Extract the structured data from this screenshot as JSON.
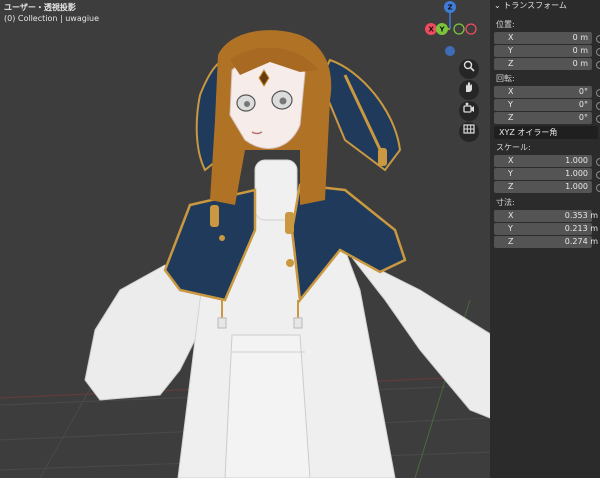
{
  "viewport": {
    "title": "ユーザー・透視投影",
    "subtitle": "(0) Collection | uwagiue",
    "gizmo": {
      "z": "Z",
      "x": "X",
      "y": "Y"
    },
    "nav_icons": [
      "zoom-icon",
      "hand-icon",
      "camera-icon",
      "grid-icon"
    ]
  },
  "panel": {
    "header": "トランスフォーム",
    "location": {
      "label": "位置:",
      "rows": [
        {
          "axis": "X",
          "value": "0 m"
        },
        {
          "axis": "Y",
          "value": "0 m"
        },
        {
          "axis": "Z",
          "value": "0 m"
        }
      ]
    },
    "rotation": {
      "label": "回転:",
      "rows": [
        {
          "axis": "X",
          "value": "0°"
        },
        {
          "axis": "Y",
          "value": "0°"
        },
        {
          "axis": "Z",
          "value": "0°"
        }
      ],
      "mode": "XYZ オイラー角"
    },
    "scale": {
      "label": "スケール:",
      "rows": [
        {
          "axis": "X",
          "value": "1.000"
        },
        {
          "axis": "Y",
          "value": "1.000"
        },
        {
          "axis": "Z",
          "value": "1.000"
        }
      ]
    },
    "dimensions": {
      "label": "寸法:",
      "rows": [
        {
          "axis": "X",
          "value": "0.353 m"
        },
        {
          "axis": "Y",
          "value": "0.213 m"
        },
        {
          "axis": "Z",
          "value": "0.274 m"
        }
      ]
    }
  },
  "colors": {
    "axis_x": "#ee4b5f",
    "axis_y": "#7bc53a",
    "axis_z": "#3f7ddb",
    "coat_navy": "#1f3a5a",
    "gold_trim": "#c99840",
    "hair": "#b07326"
  }
}
